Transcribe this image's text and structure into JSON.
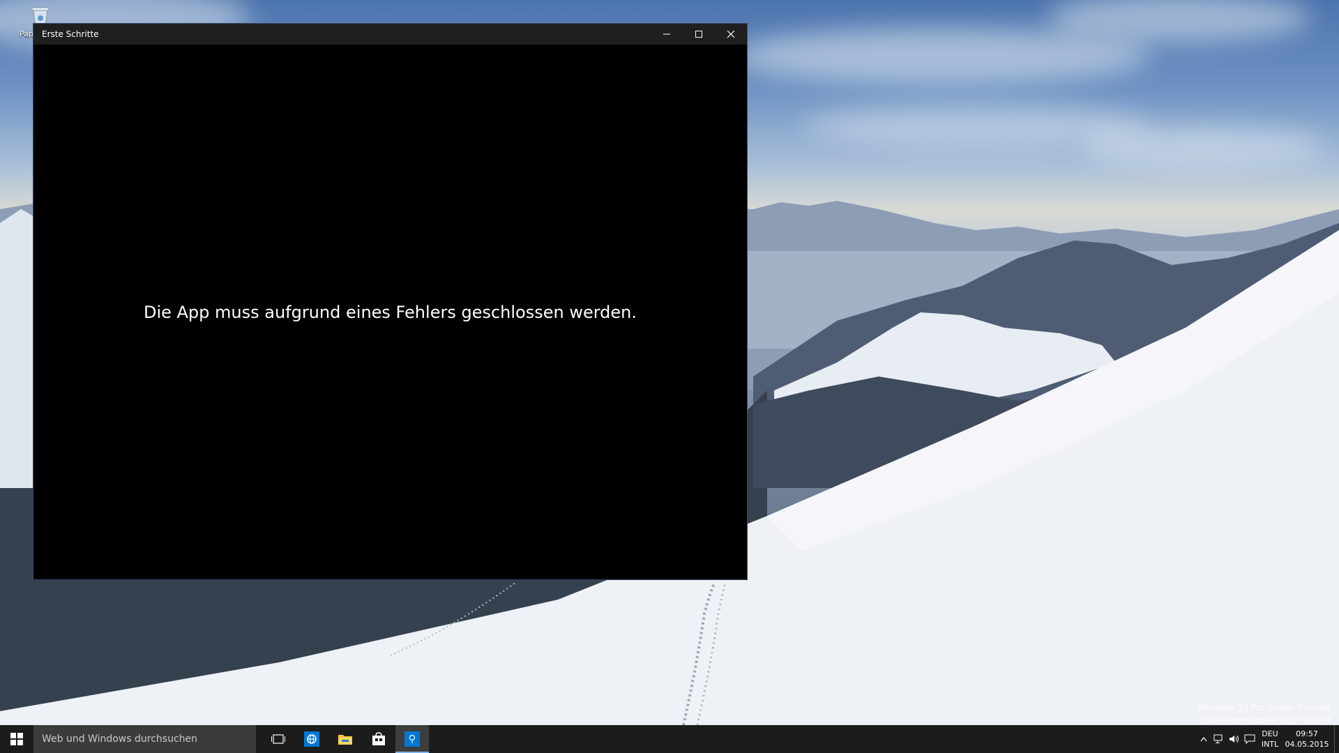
{
  "desktop": {
    "recycle_bin_label": "Papierkorb"
  },
  "window": {
    "title": "Erste Schritte",
    "error_message": "Die App muss aufgrund eines Fehlers geschlossen werden."
  },
  "watermark": {
    "line1": "Windows 10 Pro Insider Preview",
    "line2": "Evaluierungskopie Build 10114"
  },
  "taskbar": {
    "search_placeholder": "Web und Windows durchsuchen",
    "icons": [
      "task-view-icon",
      "edge-browser-icon",
      "file-explorer-icon",
      "store-icon",
      "tips-app-icon"
    ],
    "tray": {
      "language_top": "DEU",
      "language_bottom": "INTL",
      "time": "09:57",
      "date": "04.05.2015"
    }
  },
  "colors": {
    "title_bar": "#1f1f1f",
    "window_bg": "#000000",
    "taskbar_bg": "#1c1c1c",
    "accent": "#0078d7"
  }
}
